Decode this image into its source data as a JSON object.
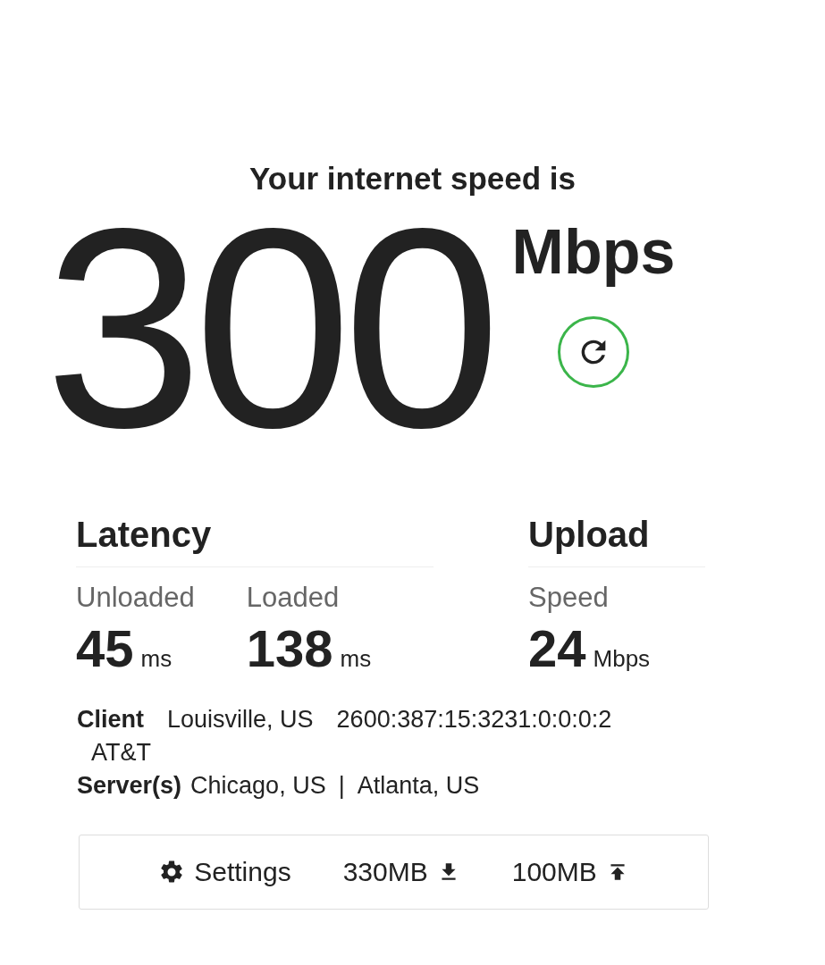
{
  "headline": "Your internet speed is",
  "speed": {
    "value": "300",
    "unit": "Mbps"
  },
  "groups": [
    {
      "title": "Latency",
      "metrics": [
        {
          "label": "Unloaded",
          "value": "45",
          "unit": "ms"
        },
        {
          "label": "Loaded",
          "value": "138",
          "unit": "ms"
        }
      ]
    },
    {
      "title": "Upload",
      "metrics": [
        {
          "label": "Speed",
          "value": "24",
          "unit": "Mbps"
        }
      ]
    }
  ],
  "client": {
    "label": "Client",
    "location": "Louisville, US",
    "ip": "2600:387:15:3231:0:0:0:2",
    "isp": "AT&T"
  },
  "servers": {
    "label": "Server(s)",
    "locations": [
      "Chicago, US",
      "Atlanta, US"
    ],
    "separator": "|"
  },
  "footer": {
    "settings": "Settings",
    "transfers": [
      {
        "kind": "download",
        "text": "330MB"
      },
      {
        "kind": "upload",
        "text": "100MB"
      }
    ]
  }
}
